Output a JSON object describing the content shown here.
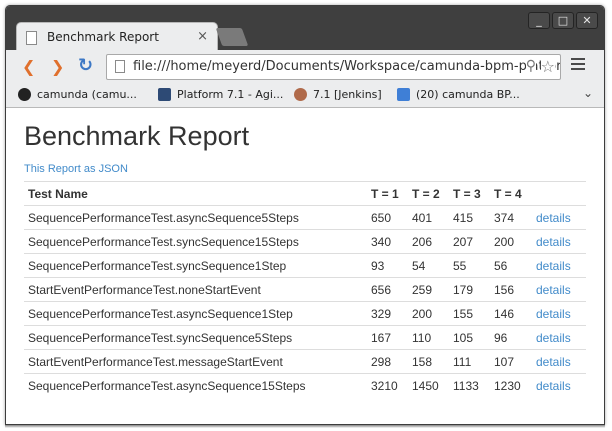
{
  "tab": {
    "title": "Benchmark Report",
    "close": "×"
  },
  "window_controls": {
    "minimize": "_",
    "maximize": "□",
    "close": "✕"
  },
  "toolbar": {
    "back": "❮",
    "forward": "❯",
    "reload": "↻",
    "url": "file:///home/meyerd/Documents/Workspace/camunda-bpm-platform",
    "search_icon": "⚲",
    "star_icon": "☆"
  },
  "bookmarks": [
    {
      "label": "camunda (camu..."
    },
    {
      "label": "Platform 7.1 - Agi..."
    },
    {
      "label": "7.1 [Jenkins]"
    },
    {
      "label": "(20) camunda BP..."
    }
  ],
  "bookmarks_more": "⌄",
  "page": {
    "title": "Benchmark Report",
    "json_link": "This Report as JSON",
    "columns": [
      "Test Name",
      "T = 1",
      "T = 2",
      "T = 3",
      "T = 4",
      ""
    ],
    "rows": [
      {
        "name": "SequencePerformanceTest.asyncSequence5Steps",
        "t1": "650",
        "t2": "401",
        "t3": "415",
        "t4": "374",
        "link": "details"
      },
      {
        "name": "SequencePerformanceTest.syncSequence15Steps",
        "t1": "340",
        "t2": "206",
        "t3": "207",
        "t4": "200",
        "link": "details"
      },
      {
        "name": "SequencePerformanceTest.syncSequence1Step",
        "t1": "93",
        "t2": "54",
        "t3": "55",
        "t4": "56",
        "link": "details"
      },
      {
        "name": "StartEventPerformanceTest.noneStartEvent",
        "t1": "656",
        "t2": "259",
        "t3": "179",
        "t4": "156",
        "link": "details"
      },
      {
        "name": "SequencePerformanceTest.asyncSequence1Step",
        "t1": "329",
        "t2": "200",
        "t3": "155",
        "t4": "146",
        "link": "details"
      },
      {
        "name": "SequencePerformanceTest.syncSequence5Steps",
        "t1": "167",
        "t2": "110",
        "t3": "105",
        "t4": "96",
        "link": "details"
      },
      {
        "name": "StartEventPerformanceTest.messageStartEvent",
        "t1": "298",
        "t2": "158",
        "t3": "111",
        "t4": "107",
        "link": "details"
      },
      {
        "name": "SequencePerformanceTest.asyncSequence15Steps",
        "t1": "3210",
        "t2": "1450",
        "t3": "1133",
        "t4": "1230",
        "link": "details"
      }
    ]
  }
}
